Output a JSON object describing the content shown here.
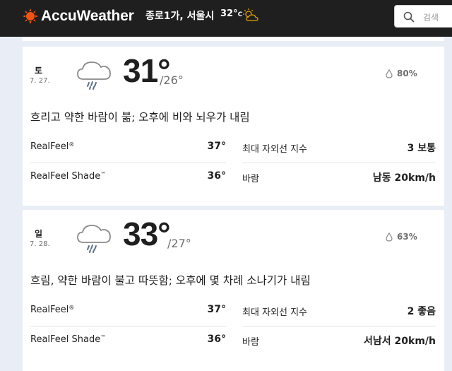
{
  "header": {
    "brand": "AccuWeather",
    "location": "종로1가, 서울시",
    "temp": "32°",
    "temp_unit": "C",
    "search_placeholder": "검색",
    "icons": {
      "brand": "sun-logo-icon",
      "weather": "partly-cloudy-icon",
      "search": "search-icon"
    }
  },
  "days": [
    {
      "dow": "토",
      "date": "7. 27.",
      "icon": "rain-cloud-icon",
      "high": "31°",
      "low": "/26°",
      "precip": "80%",
      "phrase": "흐리고 약한 바람이 붊; 오후에 비와 뇌우가 내림",
      "realfeel_label": "RealFeel",
      "realfeel_mark": "®",
      "realfeel": "37°",
      "realfeel_shade_label": "RealFeel Shade",
      "realfeel_shade_mark": "™",
      "realfeel_shade": "36°",
      "uv_label": "최대 자외선 지수",
      "uv": "3 보통",
      "wind_label": "바람",
      "wind": "남동 20km/h"
    },
    {
      "dow": "일",
      "date": "7. 28.",
      "icon": "rain-cloud-icon",
      "high": "33°",
      "low": "/27°",
      "precip": "63%",
      "phrase": "흐림, 약한 바람이 불고 따뜻함; 오후에 몇 차례 소나기가 내림",
      "realfeel_label": "RealFeel",
      "realfeel_mark": "®",
      "realfeel": "37°",
      "realfeel_shade_label": "RealFeel Shade",
      "realfeel_shade_mark": "™",
      "realfeel_shade": "36°",
      "uv_label": "최대 자외선 지수",
      "uv": "2 좋음",
      "wind_label": "바람",
      "wind": "서남서 20km/h"
    }
  ],
  "colors": {
    "header_bg": "#1f1f1f",
    "brand_orange": "#f05514",
    "page_bg": "#e9eef6",
    "card_bg": "#ffffff",
    "muted_text": "#6e6e6e"
  }
}
